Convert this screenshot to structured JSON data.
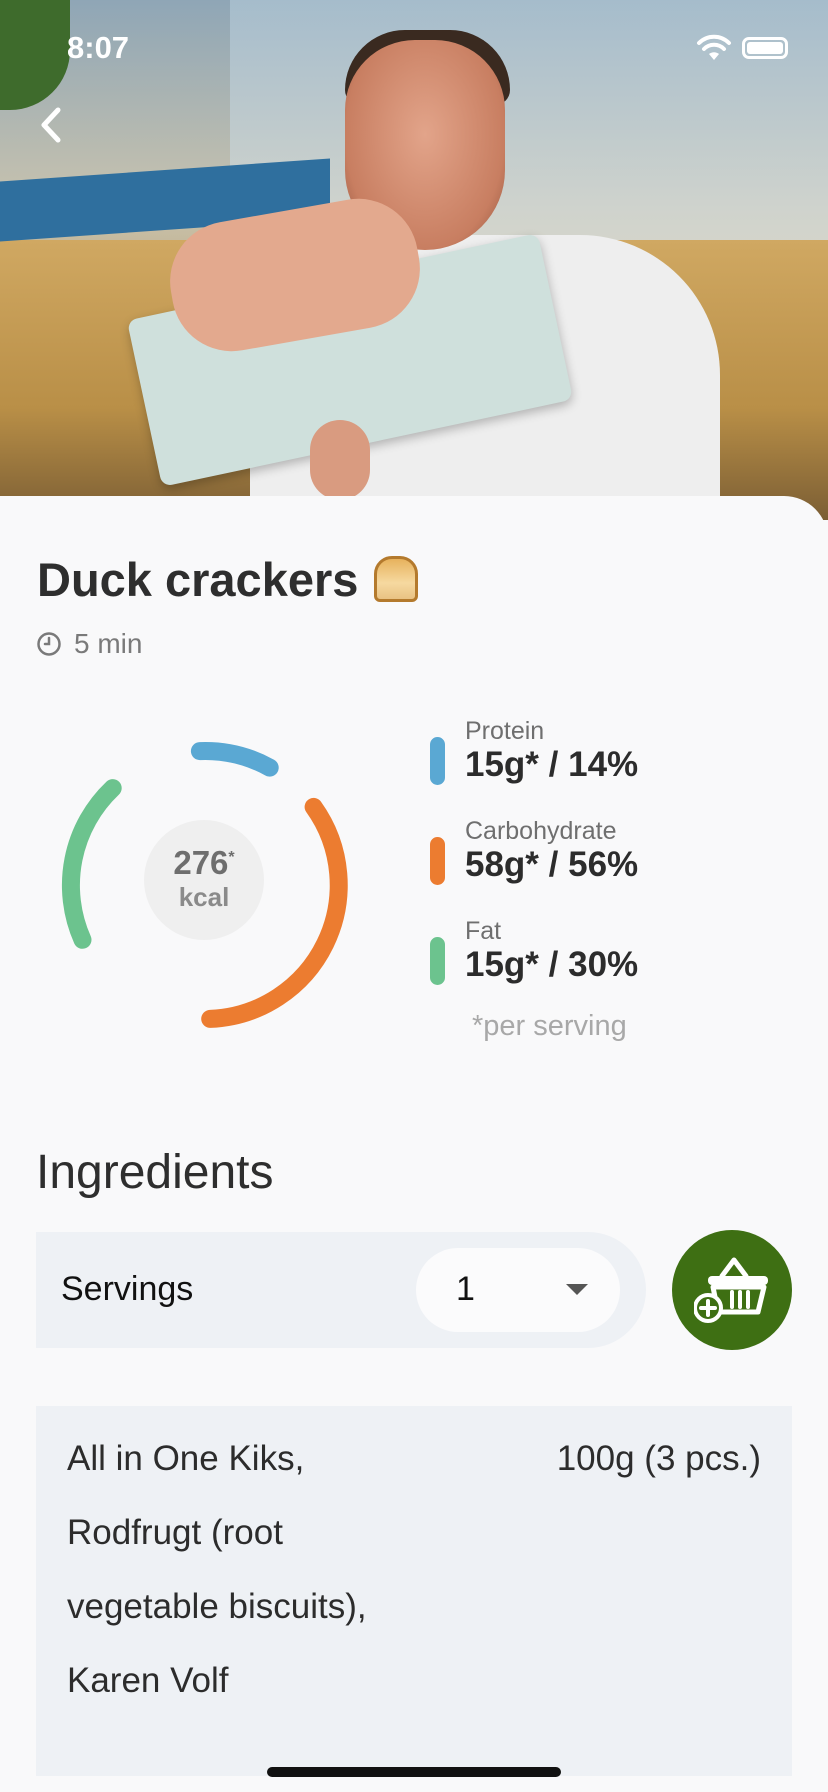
{
  "status_bar": {
    "time": "8:07"
  },
  "recipe": {
    "title": "Duck crackers",
    "duration": "5 min"
  },
  "nutrition": {
    "kcal_value": "276",
    "kcal_asterisk": "*",
    "kcal_unit": "kcal",
    "macros": [
      {
        "label": "Protein",
        "value": "15g* / 14%",
        "color": "#5aa8d3"
      },
      {
        "label": "Carbohydrate",
        "value": "58g* / 56%",
        "color": "#ec7c30"
      },
      {
        "label": "Fat",
        "value": "15g* / 30%",
        "color": "#6cc38e"
      }
    ],
    "per_serving_note": "*per serving"
  },
  "ingredients": {
    "heading": "Ingredients",
    "servings_label": "Servings",
    "servings_value": "1",
    "items": [
      {
        "name": "All in One Kiks, Rodfrugt (root vegetable biscuits), Karen Volf",
        "amount": "100g (3 pcs.)"
      }
    ]
  },
  "icons": {
    "back": "chevron-left-icon",
    "clock": "clock-icon",
    "basket": "add-to-basket-icon",
    "wifi": "wifi-icon",
    "battery": "battery-icon"
  },
  "colors": {
    "basket_button": "#3e6f13",
    "protein": "#5aa8d3",
    "carbohydrate": "#ec7c30",
    "fat": "#6cc38e"
  }
}
